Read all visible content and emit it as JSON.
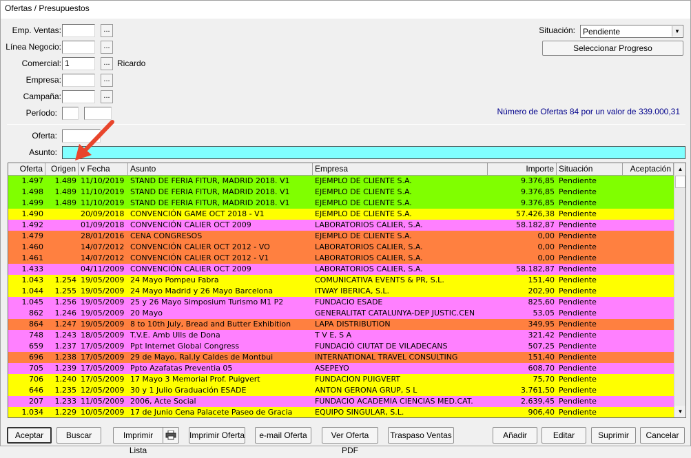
{
  "window": {
    "title": "Ofertas / Presupuestos"
  },
  "filters": {
    "emp_ventas": {
      "label": "Emp. Ventas:",
      "value": ""
    },
    "linea_negocio": {
      "label": "Línea Negocio:",
      "value": ""
    },
    "comercial": {
      "label": "Comercial:",
      "value": "1",
      "name": "Ricardo"
    },
    "empresa": {
      "label": "Empresa:",
      "value": ""
    },
    "campana": {
      "label": "Campaña:",
      "value": ""
    },
    "periodo": {
      "label": "Período:",
      "from": "",
      "to": ""
    },
    "lookup_button": "..."
  },
  "situacion": {
    "label": "Situación:",
    "value": "Pendiente",
    "progress_button": "Seleccionar Progreso"
  },
  "summary": "Número de Ofertas 84 por un valor de 339.000,31",
  "search": {
    "oferta": {
      "label": "Oferta:",
      "value": ""
    },
    "asunto": {
      "label": "Asunto:",
      "value": "",
      "color": "#80ffff"
    }
  },
  "table": {
    "columns": [
      "Oferta",
      "Origen",
      "v Fecha",
      "Asunto",
      "Empresa",
      "Importe",
      "Situación",
      "Aceptación"
    ],
    "row_colors": {
      "green": "#80ff00",
      "yellow": "#ffff00",
      "pink": "#ff80ff",
      "orange": "#ff8040"
    },
    "rows": [
      {
        "color": "green",
        "cells": [
          "1.497",
          "1.489",
          "11/10/2019",
          "STAND DE FERIA FITUR, MADRID 2018. V1",
          "EJEMPLO DE CLIENTE S.A.",
          "9.376,85",
          "Pendiente",
          ""
        ]
      },
      {
        "color": "green",
        "cells": [
          "1.498",
          "1.489",
          "11/10/2019",
          "STAND DE FERIA FITUR, MADRID 2018. V1",
          "EJEMPLO DE CLIENTE S.A.",
          "9.376,85",
          "Pendiente",
          ""
        ]
      },
      {
        "color": "green",
        "cells": [
          "1.499",
          "1.489",
          "11/10/2019",
          "STAND DE FERIA FITUR, MADRID 2018. V1",
          "EJEMPLO DE CLIENTE S.A.",
          "9.376,85",
          "Pendiente",
          ""
        ]
      },
      {
        "color": "yellow",
        "cells": [
          "1.490",
          "",
          "20/09/2018",
          "CONVENCIÓN GAME OCT 2018 - V1",
          "EJEMPLO DE CLIENTE S.A.",
          "57.426,38",
          "Pendiente",
          ""
        ]
      },
      {
        "color": "pink",
        "cells": [
          "1.492",
          "",
          "01/09/2018",
          "CONVENCIÓN CALIER OCT 2009",
          "LABORATORIOS CALIER, S.A.",
          "58.182,87",
          "Pendiente",
          ""
        ]
      },
      {
        "color": "orange",
        "cells": [
          "1.479",
          "",
          "28/01/2016",
          "CENA CONGRESOS",
          "EJEMPLO DE CLIENTE S.A.",
          "0,00",
          "Pendiente",
          ""
        ]
      },
      {
        "color": "orange",
        "cells": [
          "1.460",
          "",
          "14/07/2012",
          "CONVENCIÓN CALIER OCT 2012 - VO",
          "LABORATORIOS CALIER, S.A.",
          "0,00",
          "Pendiente",
          ""
        ]
      },
      {
        "color": "orange",
        "cells": [
          "1.461",
          "",
          "14/07/2012",
          "CONVENCIÓN CALIER OCT 2012 - V1",
          "LABORATORIOS CALIER, S.A.",
          "0,00",
          "Pendiente",
          ""
        ]
      },
      {
        "color": "pink",
        "cells": [
          "1.433",
          "",
          "04/11/2009",
          "CONVENCIÓN CALIER OCT 2009",
          "LABORATORIOS CALIER, S.A.",
          "58.182,87",
          "Pendiente",
          ""
        ]
      },
      {
        "color": "yellow",
        "cells": [
          "1.043",
          "1.254",
          "19/05/2009",
          "24 Mayo Pompeu Fabra",
          "COMUNICATIVA EVENTS & PR, S.L.",
          "151,40",
          "Pendiente",
          ""
        ]
      },
      {
        "color": "yellow",
        "cells": [
          "1.044",
          "1.255",
          "19/05/2009",
          "24 Mayo Madrid y 26 Mayo Barcelona",
          "ITWAY IBERICA, S.L.",
          "202,90",
          "Pendiente",
          ""
        ]
      },
      {
        "color": "pink",
        "cells": [
          "1.045",
          "1.256",
          "19/05/2009",
          "25 y 26 Mayo Simposium Turismo M1 P2",
          "FUNDACIO ESADE",
          "825,60",
          "Pendiente",
          ""
        ]
      },
      {
        "color": "pink",
        "cells": [
          "862",
          "1.246",
          "19/05/2009",
          "20 Mayo",
          "GENERALITAT CATALUNYA-DEP JUSTIC.CEN",
          "53,05",
          "Pendiente",
          ""
        ]
      },
      {
        "color": "orange",
        "cells": [
          "864",
          "1.247",
          "19/05/2009",
          "8 to 10th July, Bread and Butter Exhibition",
          "LAPA DISTRIBUTION",
          "349,95",
          "Pendiente",
          ""
        ]
      },
      {
        "color": "pink",
        "cells": [
          "748",
          "1.243",
          "18/05/2009",
          "T.V.E. Amb Ulls de Dona",
          "T V E, S A",
          "321,42",
          "Pendiente",
          ""
        ]
      },
      {
        "color": "pink",
        "cells": [
          "659",
          "1.237",
          "17/05/2009",
          "Ppt Internet Global Congress",
          "FUNDACIÓ CIUTAT DE VILADECANS",
          "507,25",
          "Pendiente",
          ""
        ]
      },
      {
        "color": "orange",
        "cells": [
          "696",
          "1.238",
          "17/05/2009",
          "29 de Mayo, Ral.ly Caldes de Montbui",
          "INTERNATIONAL TRAVEL CONSULTING",
          "151,40",
          "Pendiente",
          ""
        ]
      },
      {
        "color": "pink",
        "cells": [
          "705",
          "1.239",
          "17/05/2009",
          "Ppto Azafatas Preventia 05",
          "ASEPEYO",
          "608,70",
          "Pendiente",
          ""
        ]
      },
      {
        "color": "yellow",
        "cells": [
          "706",
          "1.240",
          "17/05/2009",
          "17 Mayo  3 Memorial Prof. Puigvert",
          "FUNDACION PUIGVERT",
          "75,70",
          "Pendiente",
          ""
        ]
      },
      {
        "color": "yellow",
        "cells": [
          "646",
          "1.235",
          "12/05/2009",
          "30 y 1 Julio Graduación ESADE",
          "ANTON GERONA GRUP, S L",
          "3.761,50",
          "Pendiente",
          ""
        ]
      },
      {
        "color": "pink",
        "cells": [
          "207",
          "1.233",
          "11/05/2009",
          "2006, Acte Social",
          "FUNDACIO ACADEMIA CIENCIAS MED.CAT.",
          "2.639,45",
          "Pendiente",
          ""
        ]
      },
      {
        "color": "yellow",
        "cells": [
          "1.034",
          "1.229",
          "10/05/2009",
          "17 de Junio Cena Palacete Paseo de Gracia",
          "EQUIPO SINGULAR, S.L.",
          "906,40",
          "Pendiente",
          ""
        ]
      }
    ]
  },
  "buttons": {
    "aceptar": "Aceptar",
    "buscar": "Buscar",
    "imprimir_lista": "Imprimir Lista",
    "imprimir_oferta": "Imprimir Oferta",
    "email_oferta": "e-mail Oferta",
    "ver_oferta_pdf": "Ver Oferta PDF",
    "traspaso_ventas": "Traspaso Ventas",
    "anadir": "Añadir",
    "editar": "Editar",
    "suprimir": "Suprimir",
    "cancelar": "Cancelar"
  },
  "icons": {
    "printer": "printer-icon",
    "annotation": "red-arrow-annotation"
  }
}
